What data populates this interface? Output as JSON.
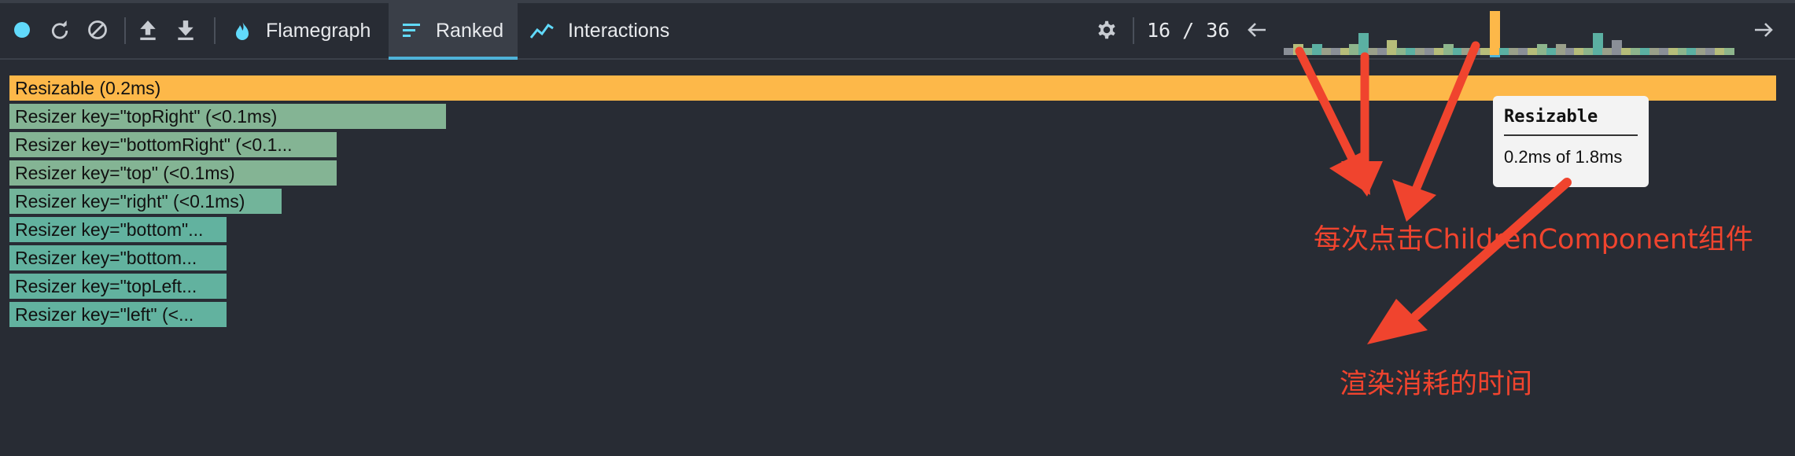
{
  "toolbar": {
    "tabs": [
      "Flamegraph",
      "Ranked",
      "Interactions"
    ],
    "counter": "16 / 36",
    "accent": "#4fb3d9"
  },
  "commits": {
    "values": [
      2,
      3,
      2,
      3,
      2,
      2,
      2,
      3,
      6,
      2,
      2,
      4,
      2,
      2,
      2,
      2,
      2,
      3,
      2,
      2,
      2,
      2,
      12,
      2,
      2,
      2,
      2,
      3,
      2,
      3,
      2,
      2,
      2,
      6,
      2,
      4,
      2,
      2,
      2,
      2,
      2,
      2,
      2,
      2,
      2,
      2,
      2,
      2
    ],
    "selected_index": 22
  },
  "ranked": [
    {
      "label": "Resizable (0.2ms)",
      "frac": 1.0,
      "color": "#fdb849"
    },
    {
      "label": "Resizer key=\"topRight\" (<0.1ms)",
      "frac": 0.247,
      "color": "#84b494"
    },
    {
      "label": "Resizer key=\"bottomRight\" (<0.1...",
      "frac": 0.185,
      "color": "#84b494"
    },
    {
      "label": "Resizer key=\"top\" (<0.1ms)",
      "frac": 0.185,
      "color": "#84b494"
    },
    {
      "label": "Resizer key=\"right\" (<0.1ms)",
      "frac": 0.154,
      "color": "#72b49a"
    },
    {
      "label": "Resizer key=\"bottom\"...",
      "frac": 0.123,
      "color": "#62b29f"
    },
    {
      "label": "Resizer key=\"bottom...",
      "frac": 0.123,
      "color": "#62b29f"
    },
    {
      "label": "Resizer key=\"topLeft...",
      "frac": 0.123,
      "color": "#62b29f"
    },
    {
      "label": "Resizer key=\"left\" (<...",
      "frac": 0.123,
      "color": "#62b29f"
    }
  ],
  "tooltip": {
    "title": "Resizable",
    "body": "0.2ms of 1.8ms"
  },
  "annotations": {
    "arrow_color": "#f0442e",
    "commit_note": "每次点击ChildrenComponent组件",
    "render_note": "渲染消耗的时间"
  }
}
